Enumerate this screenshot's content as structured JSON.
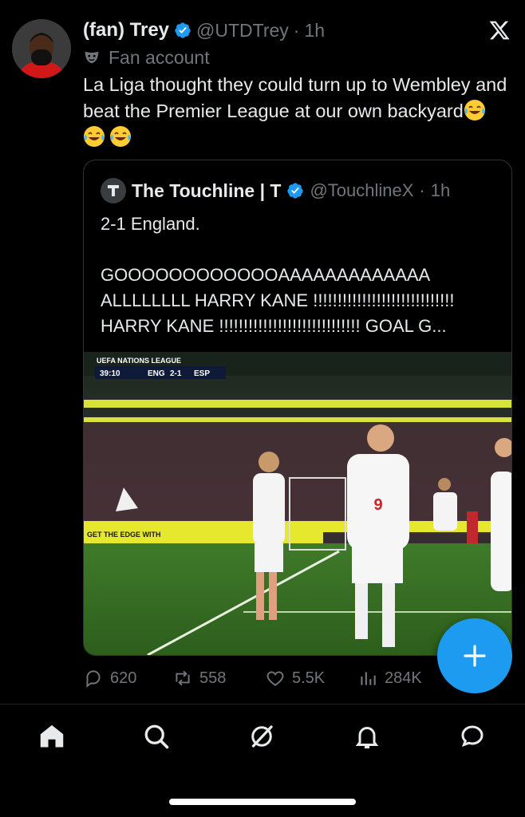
{
  "tweet": {
    "display_name": "(fan) Trey",
    "handle": "@UTDTrey",
    "separator": "·",
    "time": "1h",
    "fan_label": "Fan account",
    "text": "La Liga thought they could turn up to Wembley and beat the Premier League at our own backyard"
  },
  "quote": {
    "display_name": "The Touchline | T",
    "handle": "@TouchlineX",
    "separator": "·",
    "time": "1h",
    "text": "2-1 England.\n\nGOOOOOOOOOOOOAAAAAAAAAAAAA ALLLLLLLL HARRY KANE !!!!!!!!!!!!!!!!!!!!!!!!!!!!!\nHARRY KANE !!!!!!!!!!!!!!!!!!!!!!!!!!!!! GOAL G...",
    "media": {
      "competition": "UEFA NATIONS LEAGUE",
      "clock": "39:10",
      "home": "ENG",
      "score": "2-1",
      "away": "ESP",
      "ad_banner": "GET THE EDGE WITH",
      "shirt_number": "9"
    }
  },
  "actions": {
    "replies": "620",
    "reposts": "558",
    "likes": "5.5K",
    "views": "284K"
  },
  "colors": {
    "accent": "#1d9bf0",
    "background": "#000000",
    "secondary_text": "#71767b",
    "border": "#2f3336"
  }
}
